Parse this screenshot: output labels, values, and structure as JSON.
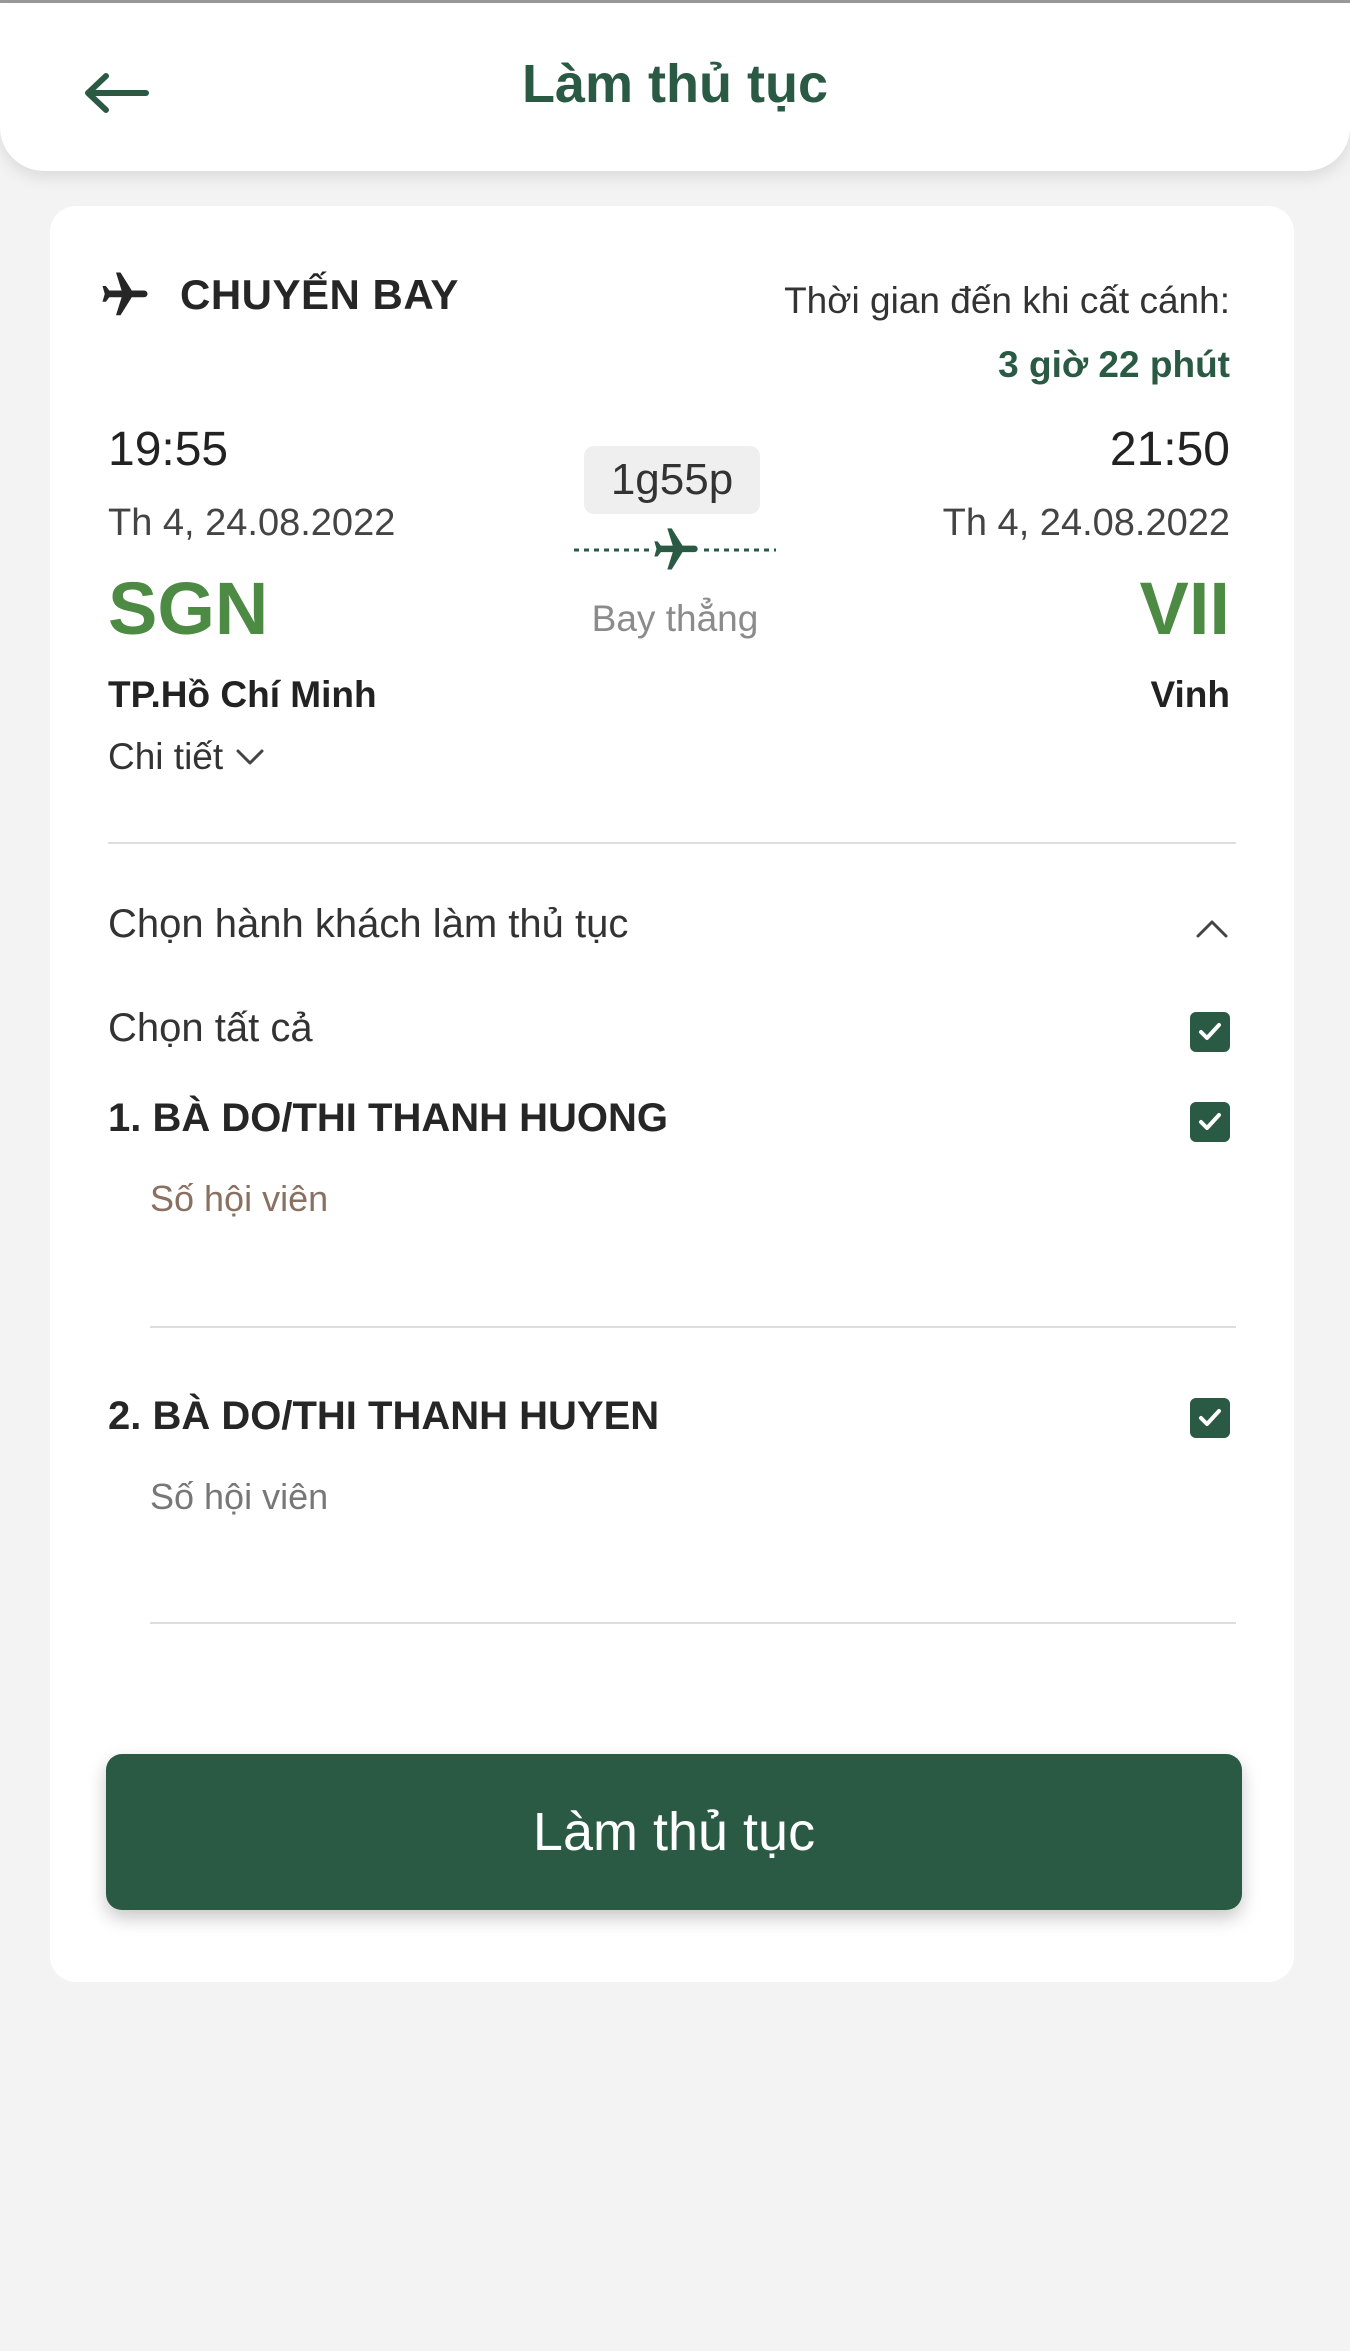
{
  "header": {
    "title": "Làm thủ tục"
  },
  "flight": {
    "label": "CHUYẾN BAY",
    "time_to_takeoff_label": "Thời gian đến khi cất cánh:",
    "time_to_takeoff_value": "3 giờ 22 phút",
    "departure": {
      "time": "19:55",
      "date": "Th 4, 24.08.2022",
      "code": "SGN",
      "city": "TP.Hồ Chí Minh"
    },
    "arrival": {
      "time": "21:50",
      "date": "Th 4, 24.08.2022",
      "code": "VII",
      "city": "Vinh"
    },
    "duration": "1g55p",
    "route_type": "Bay thẳng",
    "details_label": "Chi tiết"
  },
  "passengers": {
    "section_title": "Chọn hành khách làm thủ tục",
    "select_all_label": "Chọn tất cả",
    "select_all_checked": true,
    "list": [
      {
        "name": "1. BÀ DO/THI THANH HUONG",
        "checked": true,
        "member_placeholder": "Số hội viên"
      },
      {
        "name": "2. BÀ DO/THI THANH HUYEN",
        "checked": true,
        "member_placeholder": "Số hội viên"
      }
    ]
  },
  "actions": {
    "submit_label": "Làm thủ tục"
  },
  "colors": {
    "primary": "#2a5a43",
    "airport_code": "#4d8a43",
    "background": "#f3f3f3"
  }
}
